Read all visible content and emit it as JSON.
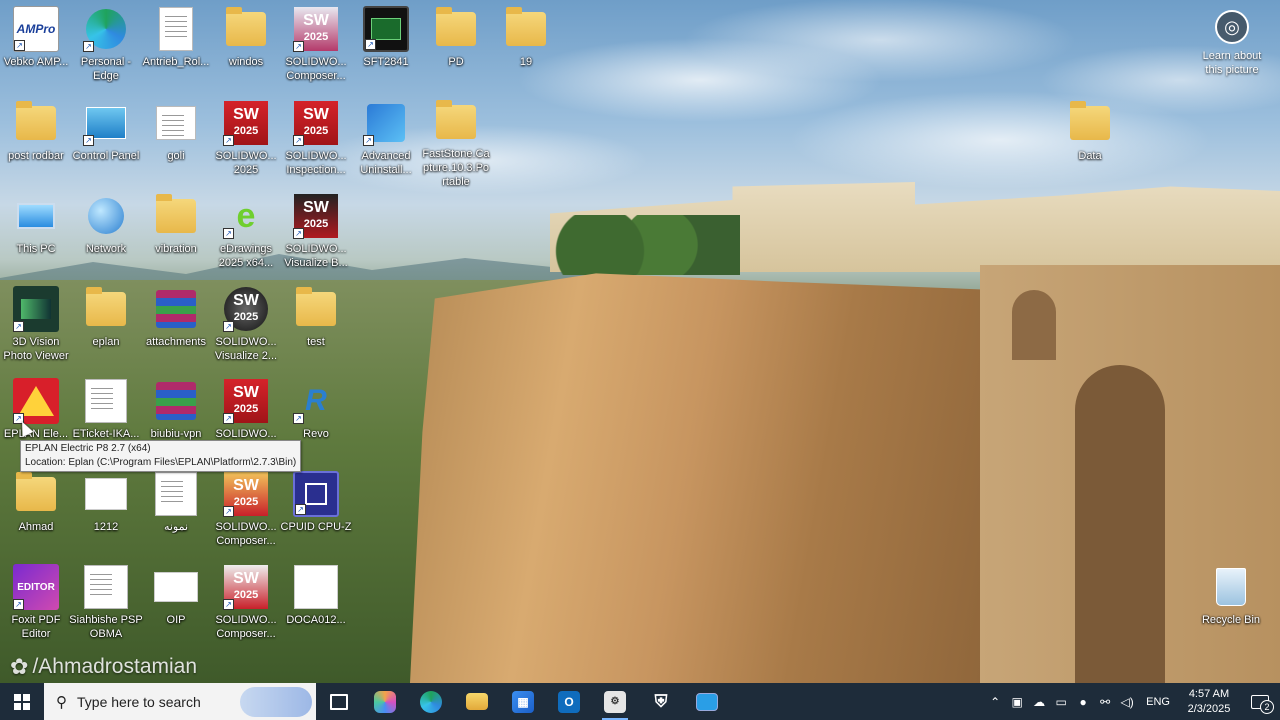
{
  "desktop": {
    "icons": [
      {
        "label": "Vebko AMP...",
        "icon": "vebko-amp-icon"
      },
      {
        "label": "Personal - Edge",
        "icon": "edge-icon"
      },
      {
        "label": "Antrieb_Rol...",
        "icon": "document-icon"
      },
      {
        "label": "windos",
        "icon": "folder-icon"
      },
      {
        "label": "SOLIDWO... Composer...",
        "icon": "solidworks-composer-icon"
      },
      {
        "label": "SFT2841",
        "icon": "sft2841-icon"
      },
      {
        "label": "PD",
        "icon": "folder-icon"
      },
      {
        "label": "19",
        "icon": "folder-icon"
      },
      {
        "label": "post rodbar",
        "icon": "folder-icon"
      },
      {
        "label": "Control Panel",
        "icon": "control-panel-icon"
      },
      {
        "label": "goli",
        "icon": "document-icon"
      },
      {
        "label": "SOLIDWO... 2025",
        "icon": "solidworks-icon"
      },
      {
        "label": "SOLIDWO... Inspection...",
        "icon": "solidworks-inspection-icon"
      },
      {
        "label": "Advanced Uninstall...",
        "icon": "advanced-uninstaller-icon"
      },
      {
        "label": "FastStone.Ca pture.10.3.Po rtable",
        "icon": "folder-icon"
      },
      {
        "label": "This PC",
        "icon": "computer-icon"
      },
      {
        "label": "Network",
        "icon": "network-icon"
      },
      {
        "label": "vibration",
        "icon": "folder-icon"
      },
      {
        "label": "eDrawings 2025 x64...",
        "icon": "edrawings-icon"
      },
      {
        "label": "SOLIDWO... Visualize B...",
        "icon": "solidworks-visualize-icon"
      },
      {
        "label": "3D Vision Photo Viewer",
        "icon": "3d-vision-icon"
      },
      {
        "label": "eplan",
        "icon": "folder-icon"
      },
      {
        "label": "attachments",
        "icon": "winrar-icon"
      },
      {
        "label": "SOLIDWO... Visualize 2...",
        "icon": "solidworks-visualize-icon"
      },
      {
        "label": "test",
        "icon": "folder-icon"
      },
      {
        "label": "EPLAN Ele...",
        "icon": "eplan-icon"
      },
      {
        "label": "ETicket-IKA...",
        "icon": "document-icon"
      },
      {
        "label": "biubiu-vpn",
        "icon": "winrar-icon"
      },
      {
        "label": "SOLIDWO...",
        "icon": "solidworks-icon"
      },
      {
        "label": "Revo",
        "icon": "revo-uninstaller-icon"
      },
      {
        "label": "Ahmad",
        "icon": "user-folder-icon"
      },
      {
        "label": "1212",
        "icon": "document-icon"
      },
      {
        "label": "نمونه",
        "icon": "document-icon"
      },
      {
        "label": "SOLIDWO... Composer...",
        "icon": "solidworks-composer-icon"
      },
      {
        "label": "CPUID CPU-Z",
        "icon": "cpu-z-icon"
      },
      {
        "label": "Foxit PDF Editor",
        "icon": "foxit-icon"
      },
      {
        "label": "Siahbishe PSP OBMA",
        "icon": "document-icon"
      },
      {
        "label": "OIP",
        "icon": "image-icon"
      },
      {
        "label": "SOLIDWO... Composer...",
        "icon": "solidworks-composer-icon"
      },
      {
        "label": "DOCA012...",
        "icon": "document-icon"
      },
      {
        "label": "Data",
        "icon": "folder-icon"
      },
      {
        "label": "Recycle Bin",
        "icon": "recycle-bin-icon"
      }
    ],
    "learn": {
      "label": "Learn about this picture",
      "icon": "camera-icon"
    },
    "tooltip": {
      "line1": "EPLAN Electric P8 2.7 (x64)",
      "line2": "Location: Eplan (C:\\Program Files\\EPLAN\\Platform\\2.7.3\\Bin)"
    },
    "watermark": "/Ahmadrostamian"
  },
  "taskbar": {
    "search_placeholder": "Type here to search",
    "apps": [
      {
        "name": "task-view-button",
        "icon": "task-view-icon"
      },
      {
        "name": "copilot-button",
        "icon": "copilot-icon"
      },
      {
        "name": "edge-button",
        "icon": "edge-icon"
      },
      {
        "name": "file-explorer-button",
        "icon": "folder-icon"
      },
      {
        "name": "store-button",
        "icon": "store-icon"
      },
      {
        "name": "outlook-button",
        "icon": "outlook-icon"
      },
      {
        "name": "eplan-taskbar-button",
        "icon": "eplan-icon"
      },
      {
        "name": "security-button",
        "icon": "shield-icon"
      },
      {
        "name": "app-button",
        "icon": "app-window-icon"
      }
    ],
    "tray": {
      "language": "ENG",
      "time": "4:57 AM",
      "date": "2/3/2025",
      "notifications": "2"
    }
  },
  "colors": {
    "taskbar_bg": "#1e2c3a",
    "solidworks_red": "#d5232a",
    "folder_yellow": "#f5d77b"
  }
}
